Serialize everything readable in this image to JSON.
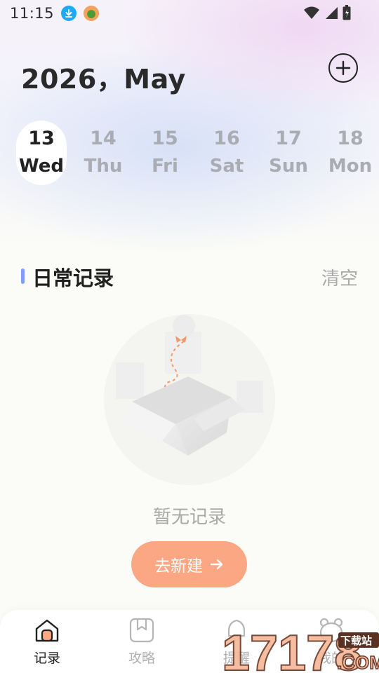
{
  "status_bar": {
    "time": "11:15"
  },
  "header": {
    "title": "2026，May"
  },
  "days": [
    {
      "num": "13",
      "weekday": "Wed",
      "selected": true
    },
    {
      "num": "14",
      "weekday": "Thu",
      "selected": false
    },
    {
      "num": "15",
      "weekday": "Fri",
      "selected": false
    },
    {
      "num": "16",
      "weekday": "Sat",
      "selected": false
    },
    {
      "num": "17",
      "weekday": "Sun",
      "selected": false
    },
    {
      "num": "18",
      "weekday": "Mon",
      "selected": false
    }
  ],
  "section": {
    "title": "日常记录",
    "clear_label": "清空"
  },
  "empty": {
    "text": "暂无记录",
    "button_label": "去新建"
  },
  "nav": [
    {
      "label": "记录",
      "icon": "home-icon",
      "active": true
    },
    {
      "label": "攻略",
      "icon": "bookmark-icon",
      "active": false
    },
    {
      "label": "提醒",
      "icon": "bell-icon",
      "active": false
    },
    {
      "label": "我的",
      "icon": "bear-icon",
      "active": false
    }
  ],
  "watermark": {
    "number": "17178",
    "site": "下载站",
    "suffix": ".COM"
  },
  "colors": {
    "accent": "#fca783",
    "section_bar": "#7e9ff7",
    "muted_text": "#a9a9a9"
  }
}
